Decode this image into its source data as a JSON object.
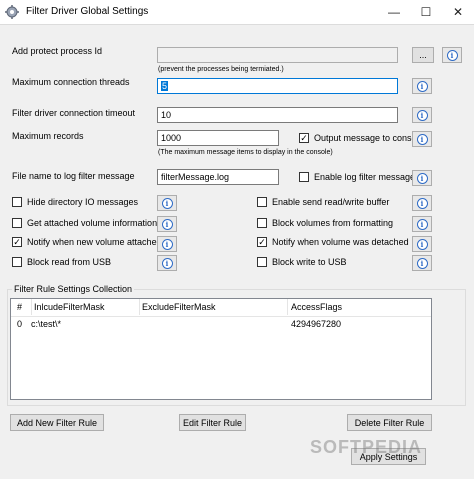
{
  "window": {
    "title": "Filter Driver Global Settings",
    "controls": {
      "minimize": "—",
      "maximize": "☐",
      "close": "✕"
    }
  },
  "protect": {
    "label": "Add protect process Id",
    "value": "",
    "note": "(prevent the processes being termiated.)",
    "browse_label": "..."
  },
  "max_threads": {
    "label": "Maximum connection threads",
    "value": "5"
  },
  "timeout": {
    "label": "Filter driver connection timeout",
    "value": "10"
  },
  "max_records": {
    "label": "Maximum records",
    "value": "1000",
    "note": "(The maximum message items to display in the console)",
    "output_label": "Output message to console",
    "output_checked": true
  },
  "log_file": {
    "label": "File name to log filter message",
    "value": "filterMessage.log",
    "enable_label": "Enable log filter message",
    "enable_checked": false
  },
  "options_left": [
    {
      "label": "Hide directory IO messages",
      "checked": false
    },
    {
      "label": "Get attached volume information",
      "checked": false
    },
    {
      "label": "Notify when new volume attached",
      "checked": true
    },
    {
      "label": "Block read from USB",
      "checked": false
    }
  ],
  "options_right": [
    {
      "label": "Enable send read/write buffer",
      "checked": false
    },
    {
      "label": "Block volumes from formatting",
      "checked": false
    },
    {
      "label": "Notify when volume was detached",
      "checked": true
    },
    {
      "label": "Block write to USB",
      "checked": false
    }
  ],
  "info_glyph": "i",
  "check_glyph": "✓",
  "rules": {
    "title": "Filter Rule Settings Collection",
    "columns": [
      "#",
      "InlcudeFilterMask",
      "ExcludeFilterMask",
      "AccessFlags"
    ],
    "rows": [
      [
        "0",
        "c:\\test\\*",
        "",
        "4294967280"
      ]
    ]
  },
  "buttons": {
    "add": "Add New Filter Rule",
    "edit": "Edit Filter Rule",
    "delete": "Delete Filter Rule",
    "apply": "Apply Settings"
  },
  "watermark": "SOFTPEDIA"
}
